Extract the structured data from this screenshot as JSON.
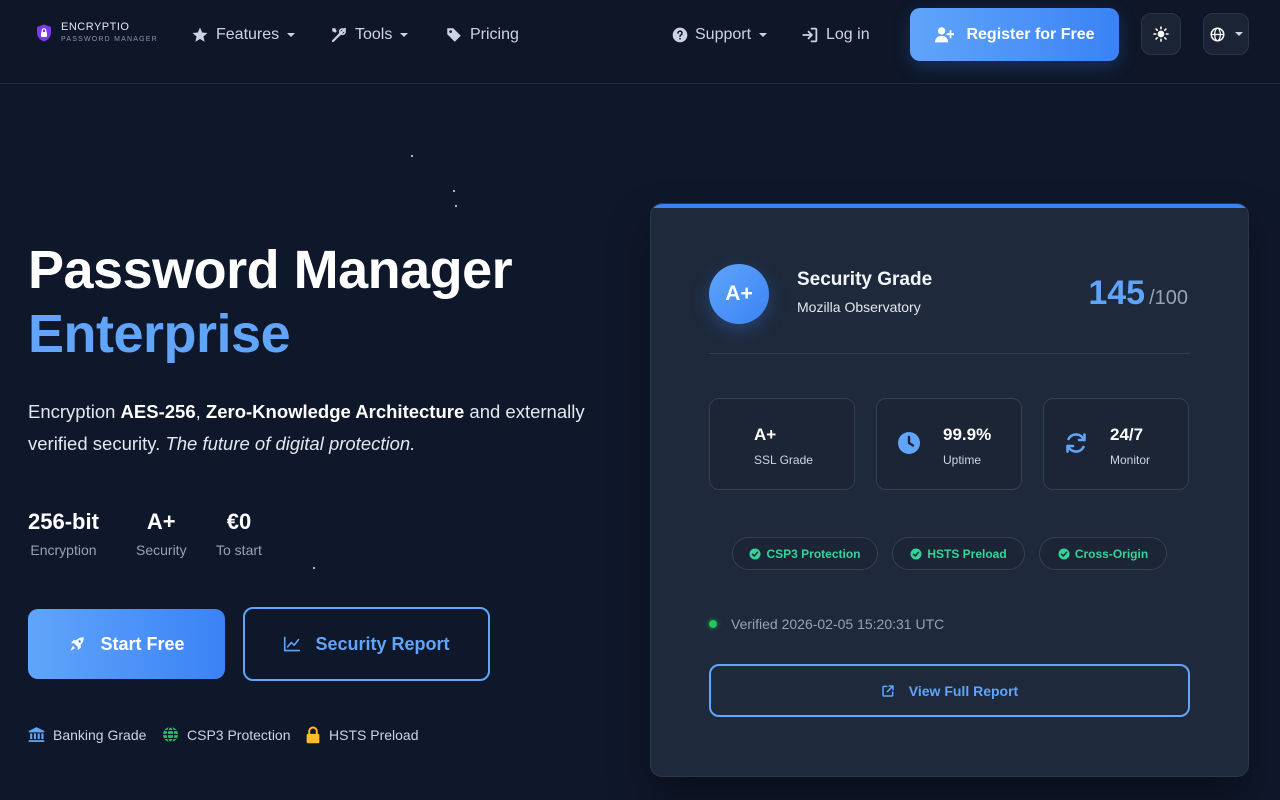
{
  "colors": {
    "background": "#0f172a",
    "navbar": "#0e1628",
    "accent": "#60a5fa",
    "accent_strong": "#3b82f6",
    "card": "#1e293b",
    "success": "#34d399",
    "lock": "#fbbf24"
  },
  "brand": {
    "name": "ENCRYPTIO",
    "tagline": "PASSWORD MANAGER",
    "icon": "shield-lock-icon"
  },
  "nav": {
    "features": {
      "label": "Features",
      "icon": "star-icon"
    },
    "tools": {
      "label": "Tools",
      "icon": "tools-icon"
    },
    "pricing": {
      "label": "Pricing",
      "icon": "tag-icon"
    },
    "support": {
      "label": "Support",
      "icon": "question-circle-icon"
    },
    "login": {
      "label": "Log in",
      "icon": "sign-in-icon"
    },
    "register": {
      "label": "Register for Free",
      "icon": "user-plus-icon"
    },
    "theme_icon": "sun-icon",
    "language_icon": "globe-icon"
  },
  "hero": {
    "title_line1": "Password Manager",
    "title_line2": "Enterprise",
    "desc_prefix": "Encryption ",
    "desc_bold1": "AES-256",
    "desc_sep": ", ",
    "desc_bold2": "Zero-Knowledge Architecture",
    "desc_mid": " and externally verified security. ",
    "desc_italic": "The future of digital protection.",
    "stats": [
      {
        "value": "256-bit",
        "label": "Encryption"
      },
      {
        "value": "A+",
        "label": "Security"
      },
      {
        "value": "€0",
        "label": "To start"
      }
    ],
    "cta_primary": {
      "label": "Start Free",
      "icon": "rocket-icon"
    },
    "cta_secondary": {
      "label": "Security Report",
      "icon": "chart-line-icon"
    },
    "trust_badges": [
      {
        "label": "Banking Grade",
        "icon": "bank-icon"
      },
      {
        "label": "CSP3 Protection",
        "icon": "globe-icon"
      },
      {
        "label": "HSTS Preload",
        "icon": "lock-icon"
      }
    ]
  },
  "card": {
    "grade": "A+",
    "title": "Security Grade",
    "source": "Mozilla Observatory",
    "score": "145",
    "score_max": "/100",
    "metrics": [
      {
        "value": "A+",
        "label": "SSL Grade",
        "icon": ""
      },
      {
        "value": "99.9%",
        "label": "Uptime",
        "icon": "clock-icon"
      },
      {
        "value": "24/7",
        "label": "Monitor",
        "icon": "sync-icon"
      }
    ],
    "badges": [
      {
        "label": "CSP3 Protection",
        "icon": "check-circle-icon"
      },
      {
        "label": "HSTS Preload",
        "icon": "check-circle-icon"
      },
      {
        "label": "Cross-Origin",
        "icon": "check-circle-icon"
      }
    ],
    "verified": "Verified 2026-02-05 15:20:31 UTC",
    "cta": {
      "label": "View Full Report",
      "icon": "external-link-icon"
    }
  }
}
